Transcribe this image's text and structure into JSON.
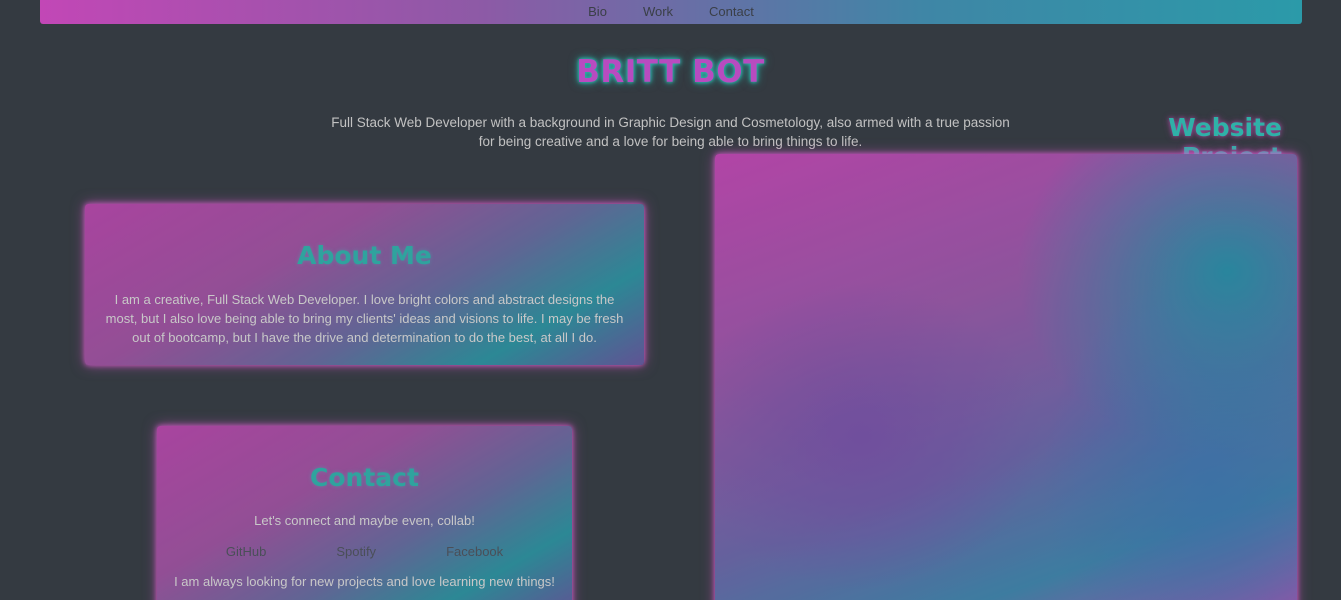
{
  "nav": {
    "items": [
      "Bio",
      "Work",
      "Contact"
    ]
  },
  "header": {
    "title": "BRITT BOT",
    "tagline_line1": "Full Stack Web Developer with a background in Graphic Design and Cosmetology, also armed with a true passion",
    "tagline_line2": "for being creative and a love for being able to bring things to life."
  },
  "about": {
    "title": "About Me",
    "line1": "I am a creative, Full Stack Web Developer. I love bright colors and abstract designs the",
    "line2": "most, but I also love being able to bring my clients' ideas and visions to life. I may be fresh",
    "line3": "out of bootcamp, but I have the drive and determination to do the best, at all I do."
  },
  "contact": {
    "title": "Contact",
    "lead": "Let's connect and maybe even, collab!",
    "links": [
      "GitHub",
      "Spotify",
      "Facebook"
    ],
    "footer": "I am always looking for new projects and love learning new things!"
  },
  "project": {
    "title": "Website Project"
  },
  "colors": {
    "background": "#343a41",
    "neon_pink": "#c247b6",
    "neon_teal": "#2fa39e"
  }
}
